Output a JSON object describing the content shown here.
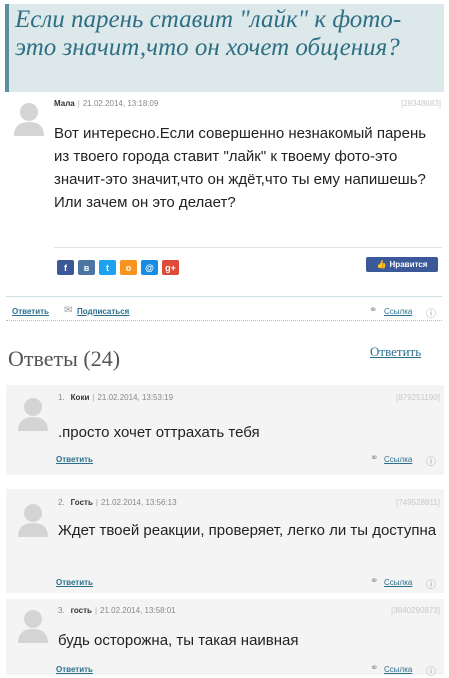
{
  "question": {
    "title": "Если парень ставит \"лайк\" к фото-это значит,что он хочет общения?",
    "author": "Мала",
    "date": "21.02.2014, 13:18:09",
    "id": "[29348683]",
    "text": "Вот интересно.Если совершенно незнакомый парень из твоего города ставит \"лайк\" к твоему фото-это значит-это значит,что он ждёт,что ты ему напишешь? Или зачем он это делает?",
    "share_icons": [
      {
        "name": "facebook-share-icon",
        "glyph": "f",
        "color": "#3b5998"
      },
      {
        "name": "vk-share-icon",
        "glyph": "в",
        "color": "#4c75a3"
      },
      {
        "name": "twitter-share-icon",
        "glyph": "t",
        "color": "#1da1f2"
      },
      {
        "name": "odnoklassniki-share-icon",
        "glyph": "о",
        "color": "#f7931e"
      },
      {
        "name": "mailru-share-icon",
        "glyph": "@",
        "color": "#168de2"
      },
      {
        "name": "googleplus-share-icon",
        "glyph": "g+",
        "color": "#dd4b39"
      }
    ],
    "like_label": "Нравится",
    "reply_label": "Ответить",
    "subscribe_label": "Подписаться",
    "link_label": "Ссылка"
  },
  "answers_header": {
    "title": "Ответы (24)",
    "reply_label": "Ответить"
  },
  "answers": [
    {
      "num": "1.",
      "author": "Коки",
      "date": "21.02.2014, 13:53:19",
      "id": "[879251190]",
      "text": ".просто хочет оттрахать тебя",
      "reply_label": "Ответить",
      "link_label": "Ссылка"
    },
    {
      "num": "2.",
      "author": "Гость",
      "date": "21.02.2014, 13:56:13",
      "id": "[749528811]",
      "text": "Ждет твоей реакции, проверяет, легко ли ты доступна",
      "reply_label": "Ответить",
      "link_label": "Ссылка"
    },
    {
      "num": "3.",
      "author": "гость",
      "date": "21.02.2014, 13:58:01",
      "id": "[3840290873]",
      "text": "будь осторожна, ты такая наивная",
      "reply_label": "Ответить",
      "link_label": "Ссылка"
    }
  ]
}
